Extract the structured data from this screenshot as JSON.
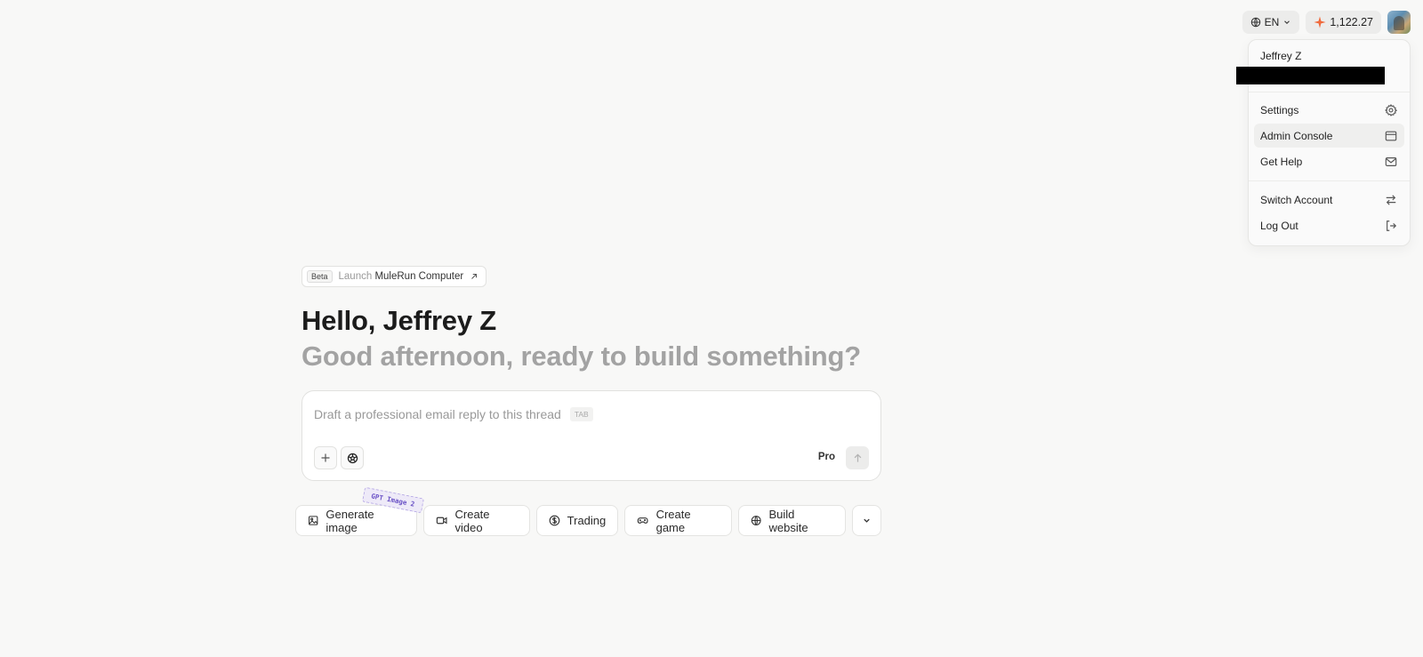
{
  "header": {
    "language": "EN",
    "credits": "1,122.27",
    "colors": {
      "credit_icon": "#f06a3c"
    }
  },
  "user_menu": {
    "user_name": "Jeffrey Z",
    "items": [
      {
        "label": "Settings",
        "icon": "gear-icon"
      },
      {
        "label": "Admin Console",
        "icon": "window-icon"
      },
      {
        "label": "Get Help",
        "icon": "mail-icon"
      },
      {
        "label": "Switch Account",
        "icon": "switch-arrows-icon"
      },
      {
        "label": "Log Out",
        "icon": "logout-icon"
      }
    ]
  },
  "banner": {
    "tag": "Beta",
    "label_faded": "Launch",
    "label_main": "MuleRun Computer"
  },
  "greeting": {
    "title": "Hello, Jeffrey Z",
    "subtitle": "Good afternoon, ready to build something?"
  },
  "composer": {
    "placeholder": "Draft a professional email reply to this thread",
    "tab_hint": "TAB",
    "mode": "Pro"
  },
  "quick_actions": [
    {
      "label": "Generate image",
      "icon": "image-icon",
      "badge": "GPT Image 2"
    },
    {
      "label": "Create video",
      "icon": "video-icon"
    },
    {
      "label": "Trading",
      "icon": "dollar-icon"
    },
    {
      "label": "Create game",
      "icon": "gamepad-icon"
    },
    {
      "label": "Build website",
      "icon": "globe-icon"
    }
  ]
}
